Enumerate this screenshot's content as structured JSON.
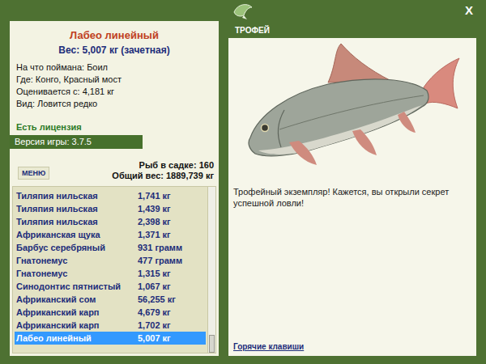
{
  "window": {
    "close": "X"
  },
  "fish": {
    "name": "Лабео линейный",
    "weight": "Вес: 5,007 кг (зачетная)",
    "details": [
      "На что поймана: Боил",
      "Где: Конго, Красный мост",
      "Оценивается с: 4,181 кг",
      "Вид: Ловится редко"
    ],
    "license": "Есть лицензия",
    "version": "Версия игры: 3.7.5"
  },
  "menu": "МЕНЮ",
  "keepnet": {
    "count": "Рыб в садке: 160",
    "total": "Общий вес: 1889,739 кг"
  },
  "catches": [
    {
      "name": "Тиляпия нильская",
      "weight": "1,741 кг",
      "selected": false
    },
    {
      "name": "Тиляпия нильская",
      "weight": "1,439 кг",
      "selected": false
    },
    {
      "name": "Тиляпия нильская",
      "weight": "2,398 кг",
      "selected": false
    },
    {
      "name": "Африканская щука",
      "weight": "1,371 кг",
      "selected": false
    },
    {
      "name": "Барбус серебряный",
      "weight": "931 грамм",
      "selected": false
    },
    {
      "name": "Гнатонемус",
      "weight": "477 грамм",
      "selected": false
    },
    {
      "name": "Гнатонемус",
      "weight": "1,315 кг",
      "selected": false
    },
    {
      "name": "Синодонтис пятнистый",
      "weight": "1,067 кг",
      "selected": false
    },
    {
      "name": "Африканский сом",
      "weight": "56,255 кг",
      "selected": false
    },
    {
      "name": "Африканский карп",
      "weight": "4,679 кг",
      "selected": false
    },
    {
      "name": "Африканский карп",
      "weight": "1,702 кг",
      "selected": false
    },
    {
      "name": "Лабео линейный",
      "weight": "5,007 кг",
      "selected": true
    }
  ],
  "scrollbar": {
    "level": 1
  },
  "trophy": {
    "header": "ТРОФЕЙ",
    "message": "Трофейный экземпляр! Кажется, вы открыли секрет успешной ловли!",
    "link": "Горячие клавиши"
  }
}
